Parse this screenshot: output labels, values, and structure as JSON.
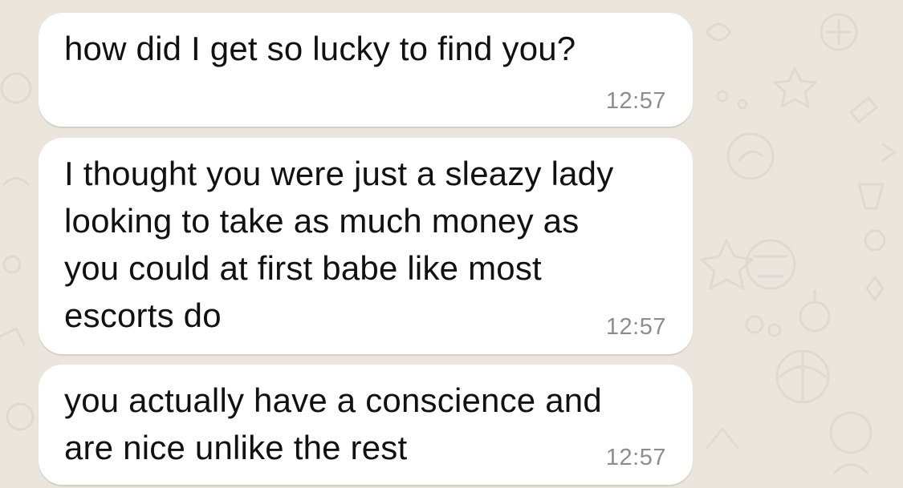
{
  "theme": {
    "background": "#ebe5de",
    "bubble": "#ffffff",
    "text": "#111111",
    "timestamp": "#8d8d8d"
  },
  "messages": [
    {
      "text": "how did I get so lucky to find you?",
      "time": "12:57"
    },
    {
      "text": "I thought you were just a sleazy lady\nlooking to take as much money as\nyou could at first babe like most\nescorts do",
      "time": "12:57"
    },
    {
      "text": "you actually have a conscience and\nare nice unlike the rest",
      "time": "12:57"
    }
  ]
}
